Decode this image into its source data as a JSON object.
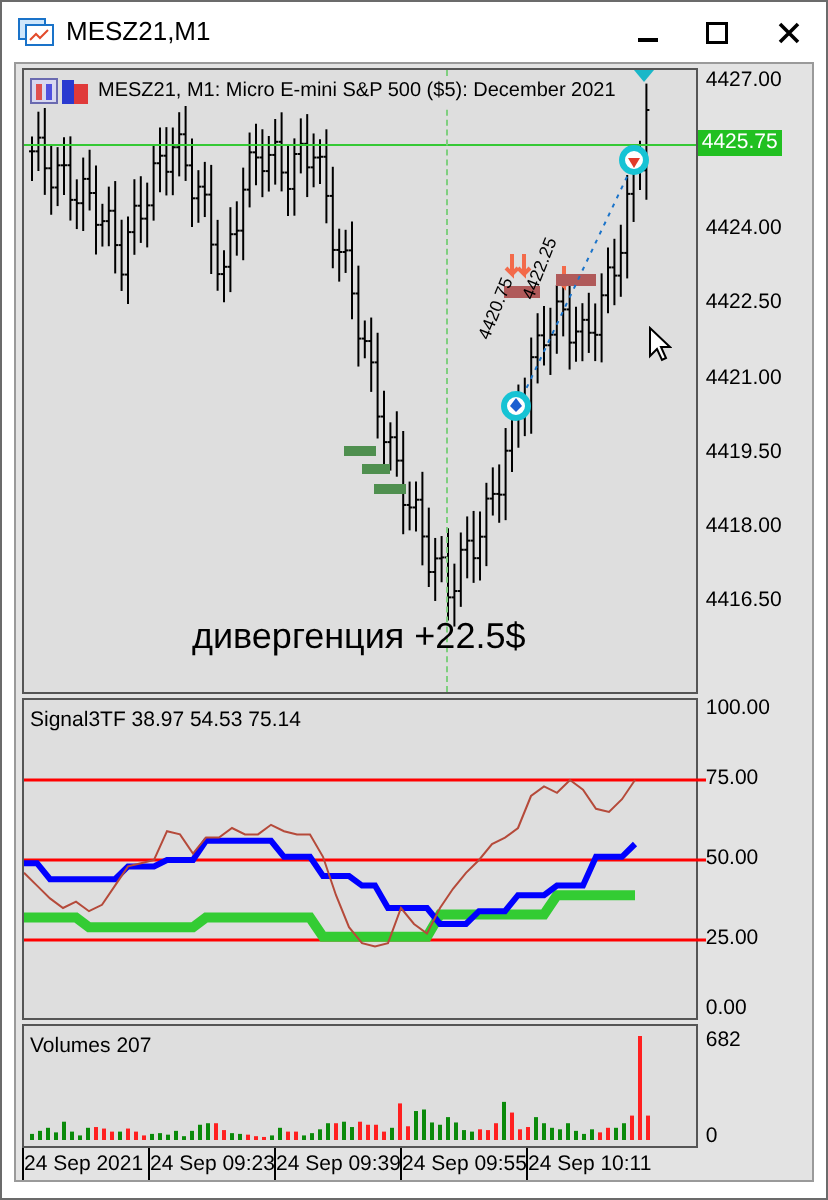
{
  "window": {
    "title": "MESZ21,M1"
  },
  "main_chart": {
    "legend": "MESZ21, M1:  Micro E-mini S&P 500 ($5): December 2021",
    "price_labels": [
      "4427.00",
      "4424.00",
      "4422.50",
      "4421.00",
      "4419.50",
      "4418.00",
      "4416.50"
    ],
    "current_price": "4425.75",
    "annotation": "дивергенция +22.5$",
    "trend_labels": [
      "4420.75",
      "4422.25"
    ]
  },
  "indicator": {
    "chart_data": {
      "type": "line",
      "grid": true,
      "title": "Signal3TF 38.97 54.53 75.14",
      "ylim": [
        0,
        100
      ],
      "yticks": [
        {
          "value": 100,
          "label": "100.00"
        },
        {
          "value": 75,
          "label": "75.00"
        },
        {
          "value": 50,
          "label": "50.00"
        },
        {
          "value": 25,
          "label": "25.00"
        },
        {
          "value": 0,
          "label": "0.00"
        }
      ],
      "series": [
        {
          "color": "#33cc33",
          "values": [
            32,
            32,
            32,
            32,
            32,
            29,
            29,
            29,
            29,
            29,
            29,
            29,
            29,
            29,
            32,
            32,
            32,
            32,
            32,
            32,
            32,
            32,
            32,
            26,
            26,
            26,
            26,
            26,
            26,
            26,
            26,
            26,
            33,
            33,
            33,
            33,
            33,
            33,
            33,
            33,
            33,
            39,
            39,
            39,
            39,
            39,
            39,
            39
          ]
        },
        {
          "color": "#0000ff",
          "values": [
            49,
            49,
            44,
            44,
            44,
            44,
            44,
            44,
            48,
            48,
            48,
            50,
            50,
            50,
            56,
            56,
            56,
            56,
            56,
            56,
            51,
            51,
            51,
            45,
            45,
            45,
            42,
            42,
            35,
            35,
            35,
            35,
            30,
            30,
            30,
            34,
            34,
            34,
            39,
            39,
            39,
            42,
            42,
            42,
            51,
            51,
            51,
            55
          ]
        },
        {
          "color": "#b54a3a",
          "values": [
            46,
            42,
            38,
            35,
            37,
            34,
            36,
            42,
            48,
            49,
            50,
            59,
            58,
            52,
            57,
            57,
            60,
            58,
            58,
            61,
            59,
            58,
            58,
            51,
            39,
            29,
            24,
            23,
            24,
            35,
            30,
            27,
            35,
            41,
            46,
            50,
            55,
            57,
            60,
            70,
            73,
            71,
            75,
            72,
            66,
            65,
            69,
            75
          ]
        }
      ]
    }
  },
  "volumes": {
    "legend": "Volumes 207",
    "scale_labels": [
      "682",
      "0"
    ]
  },
  "time_axis": [
    "24 Sep 2021",
    "24 Sep 09:23",
    "24 Sep 09:39",
    "24 Sep 09:55",
    "24 Sep 10:11"
  ]
}
